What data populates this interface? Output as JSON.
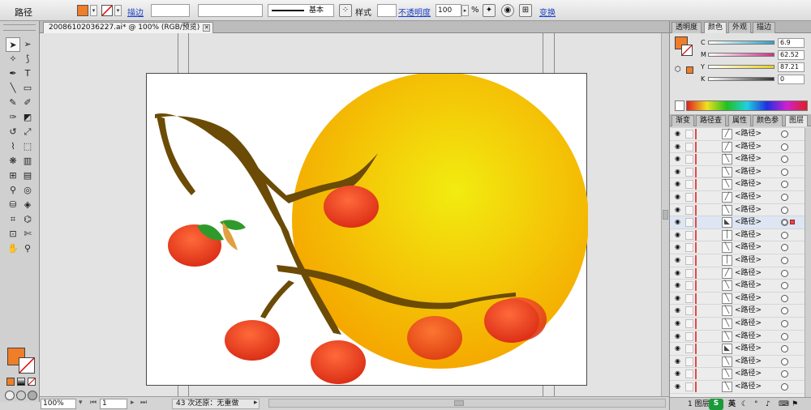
{
  "control_bar": {
    "object_type": "路径",
    "fill_color": "#f07d27",
    "stroke_label": "描边",
    "stroke_weight": "",
    "variable_width": "",
    "brush_name": "基本",
    "style_label": "样式",
    "opacity_label": "不透明度",
    "opacity_value": "100",
    "opacity_unit": "%",
    "transform_label": "变换"
  },
  "document_tab": {
    "title": "20086102036227.ai* @ 100% (RGB/预览)",
    "close": "✕"
  },
  "tools": {
    "icons": [
      "selection-icon",
      "direct-selection-icon",
      "magic-wand-icon",
      "lasso-icon",
      "pen-icon",
      "type-icon",
      "line-icon",
      "rectangle-icon",
      "paintbrush-icon",
      "pencil-icon",
      "blob-brush-icon",
      "eraser-icon",
      "rotate-icon",
      "scale-icon",
      "warp-icon",
      "free-transform-icon",
      "symbol-sprayer-icon",
      "column-graph-icon",
      "mesh-icon",
      "gradient-icon",
      "eyedropper-icon",
      "blend-icon",
      "live-paint-icon",
      "live-paint-select-icon",
      "perspective-icon",
      "perspective-select-icon",
      "crop-icon",
      "slice-icon",
      "hand-icon",
      "zoom-icon"
    ],
    "glyphs": [
      "➤",
      "➢",
      "✧",
      "⟆",
      "✒",
      "T",
      "╲",
      "▭",
      "✎",
      "✐",
      "✑",
      "◩",
      "↺",
      "⤢",
      "⌇",
      "⬚",
      "❋",
      "▥",
      "⊞",
      "▤",
      "⚲",
      "◎",
      "⛁",
      "◈",
      "⌗",
      "⌬",
      "⊡",
      "✄",
      "✋",
      "⚲"
    ],
    "fill_color": "#f07d27",
    "stroke_color": "none"
  },
  "status_bar": {
    "zoom": "100%",
    "page": "1",
    "message": "43 次还原：无重做"
  },
  "color_panel": {
    "tabs": [
      "透明度",
      "颜色",
      "外观",
      "描边"
    ],
    "active_tab": "颜色",
    "fill_color": "#f07d27",
    "channels": [
      {
        "name": "C",
        "value": "6.9",
        "color": "#2fa0c8"
      },
      {
        "name": "M",
        "value": "62.52",
        "color": "#d0308a"
      },
      {
        "name": "Y",
        "value": "87.21",
        "color": "#e8d020"
      },
      {
        "name": "K",
        "value": "0",
        "color": "#333333"
      }
    ]
  },
  "layers_panel": {
    "tabs": [
      "渐变",
      "路径查",
      "属性",
      "颜色参",
      "图层"
    ],
    "active_tab": "图层",
    "rows": [
      {
        "name": "<路径>",
        "thumb": "╱"
      },
      {
        "name": "<路径>",
        "thumb": "╱"
      },
      {
        "name": "<路径>",
        "thumb": "╲"
      },
      {
        "name": "<路径>",
        "thumb": "╲"
      },
      {
        "name": "<路径>",
        "thumb": "╲"
      },
      {
        "name": "<路径>",
        "thumb": "╱"
      },
      {
        "name": "<路径>",
        "thumb": "╲"
      },
      {
        "name": "<路径>",
        "thumb": "◣",
        "selected": true
      },
      {
        "name": "<路径>",
        "thumb": "│"
      },
      {
        "name": "<路径>",
        "thumb": "╲"
      },
      {
        "name": "<路径>",
        "thumb": "│"
      },
      {
        "name": "<路径>",
        "thumb": "╱"
      },
      {
        "name": "<路径>",
        "thumb": "╲"
      },
      {
        "name": "<路径>",
        "thumb": "╲"
      },
      {
        "name": "<路径>",
        "thumb": "╲"
      },
      {
        "name": "<路径>",
        "thumb": "╲"
      },
      {
        "name": "<路径>",
        "thumb": "╲"
      },
      {
        "name": "<路径>",
        "thumb": "◣"
      },
      {
        "name": "<路径>",
        "thumb": "╲"
      },
      {
        "name": "<路径>",
        "thumb": "╲"
      },
      {
        "name": "<路径>",
        "thumb": "╲"
      }
    ],
    "footer_label": "1 图层",
    "ime_label": "英"
  },
  "artwork": {
    "sun_inner": "#f2ec10",
    "sun_outer": "#f5a800",
    "branch": "#6b4b06",
    "fruit_light": "#ff6a3a",
    "fruit_dark": "#d92a14",
    "leaf": "#2f9a2a"
  }
}
